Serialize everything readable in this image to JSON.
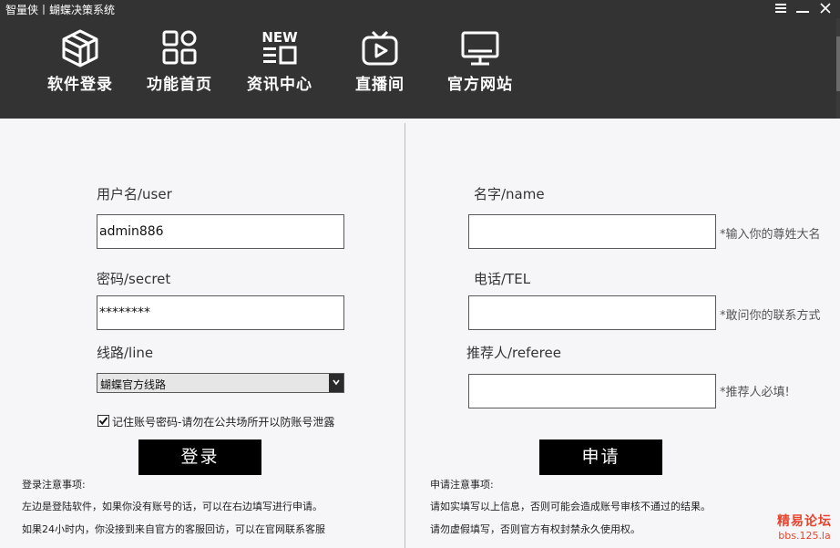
{
  "window": {
    "title": "智量侠丨蝴蝶决策系统"
  },
  "nav": {
    "items": [
      {
        "label": "软件登录",
        "icon": "cube-icon"
      },
      {
        "label": "功能首页",
        "icon": "grid-icon"
      },
      {
        "label": "资讯中心",
        "icon": "news-icon",
        "badge": "NEW"
      },
      {
        "label": "直播间",
        "icon": "tv-play-icon"
      },
      {
        "label": "官方网站",
        "icon": "monitor-icon"
      }
    ]
  },
  "login": {
    "username_label": "用户名/user",
    "username_value": "admin886",
    "password_label": "密码/secret",
    "password_value": "********",
    "line_label": "线路/line",
    "line_selected": "蝴蝶官方线路",
    "remember_label": "记住账号密码-请勿在公共场所开以防账号泄露",
    "remember_checked": true,
    "login_button": "登录",
    "notes_title": "登录注意事项:",
    "notes": [
      "左边是登陆软件，如果你没有账号的话，可以在右边填写进行申请。",
      "如果24小时内，你没接到来自官方的客服回访，可以在官网联系客服"
    ]
  },
  "apply": {
    "name_label": "名字/name",
    "name_value": "",
    "name_hint": "*输入你的尊姓大名",
    "tel_label": "电话/TEL",
    "tel_value": "",
    "tel_hint": "*敢问你的联系方式",
    "referee_label": "推荐人/referee",
    "referee_value": "",
    "referee_hint": "*推荐人必填!",
    "apply_button": "申请",
    "notes_title": "申请注意事项:",
    "notes": [
      "请如实填写以上信息，否则可能会造成账号审核不通过的结果。",
      "请勿虚假填写，否则官方有权封禁永久使用权。"
    ]
  },
  "watermark": {
    "line1": "精易论坛",
    "line2": "bbs.125.la"
  },
  "colors": {
    "header_bg": "#333333",
    "body_bg": "#f6f6f9",
    "button_bg": "#000000",
    "watermark": "#e8432c"
  }
}
